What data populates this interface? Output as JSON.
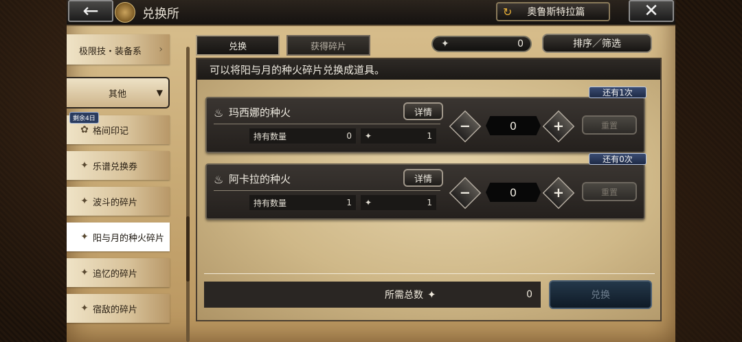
{
  "header": {
    "title": "兑换所",
    "world_button": "奥鲁斯特拉篇",
    "back_icon": "back-arrow-icon",
    "close_icon": "close-icon"
  },
  "sidebar": {
    "top_partial_item": "极限技・装备系",
    "category": "其他",
    "remain_badge": "剩余4日",
    "items": [
      {
        "label": "格间印记",
        "icon": "medal-icon"
      },
      {
        "label": "乐谱兑换券",
        "icon": "shard-icon"
      },
      {
        "label": "波斗的碎片",
        "icon": "shard-icon"
      },
      {
        "label": "阳与月的种火碎片",
        "icon": "shard-icon",
        "selected": true
      },
      {
        "label": "追忆的碎片",
        "icon": "shard-icon"
      },
      {
        "label": "宿敌的碎片",
        "icon": "shard-icon"
      }
    ]
  },
  "tabs": [
    {
      "label": "兑换",
      "active": true
    },
    {
      "label": "获得碎片",
      "active": false
    }
  ],
  "points": {
    "value": "0"
  },
  "sort_button": "排序／筛选",
  "description": "可以将阳与月的种火碎片兑换成道具。",
  "items": [
    {
      "name": "玛西娜的种火",
      "remaining": "还有1次",
      "detail_label": "详情",
      "hold_label": "持有数量",
      "hold_value": "0",
      "cost": "1",
      "quantity": "0",
      "reset_label": "重置"
    },
    {
      "name": "阿卡拉的种火",
      "remaining": "还有0次",
      "detail_label": "详情",
      "hold_label": "持有数量",
      "hold_value": "1",
      "cost": "1",
      "quantity": "0",
      "reset_label": "重置"
    }
  ],
  "footer": {
    "total_label": "所需总数",
    "total_value": "0",
    "exchange_label": "兑换"
  },
  "colors": {
    "parchment": "#d9c08f",
    "dark_panel": "#24201d",
    "badge_blue": "#2a3b5e",
    "exchange_disabled": "#24384a"
  }
}
